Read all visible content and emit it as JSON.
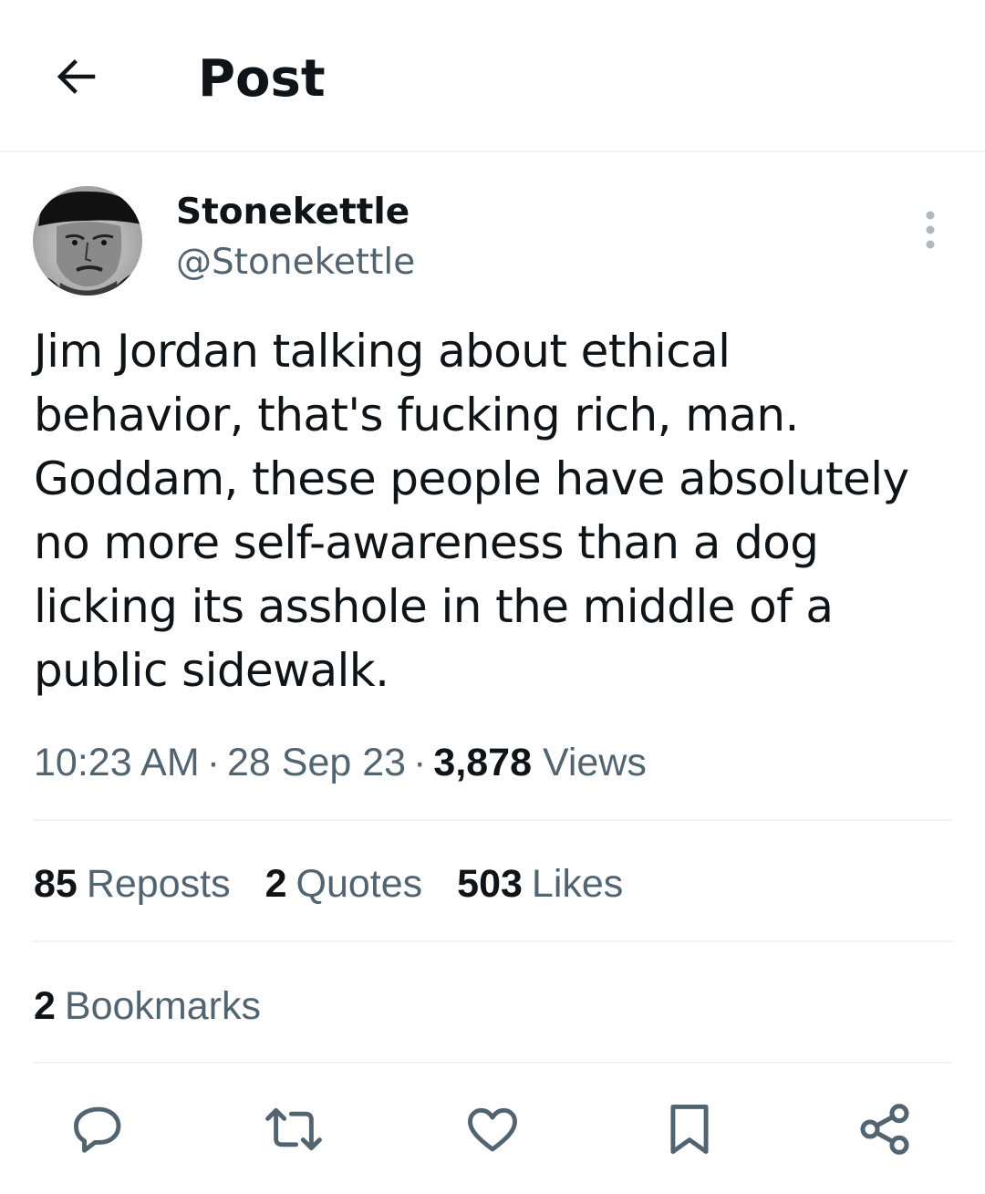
{
  "header": {
    "title": "Post",
    "back_icon": "arrow-left-icon"
  },
  "author": {
    "display_name": "Stonekettle",
    "handle": "@Stonekettle"
  },
  "post": {
    "text": "Jim Jordan talking about ethical\nbehavior, that's fucking rich, man.\nGoddam, these people have absolutely\nno more self-awareness than a dog\nlicking its asshole in the middle of a\npublic sidewalk.",
    "time": "10:23 AM",
    "date": "28 Sep 23",
    "separator": "·",
    "views_count": "3,878",
    "views_label": "Views"
  },
  "stats": {
    "reposts_count": "85",
    "reposts_label": "Reposts",
    "quotes_count": "2",
    "quotes_label": "Quotes",
    "likes_count": "503",
    "likes_label": "Likes",
    "bookmarks_count": "2",
    "bookmarks_label": "Bookmarks"
  },
  "actions": [
    "reply-icon",
    "repost-icon",
    "like-icon",
    "bookmark-icon",
    "share-icon"
  ],
  "colors": {
    "text_primary": "#0f1419",
    "text_secondary": "#536471",
    "divider": "#eff3f4"
  }
}
